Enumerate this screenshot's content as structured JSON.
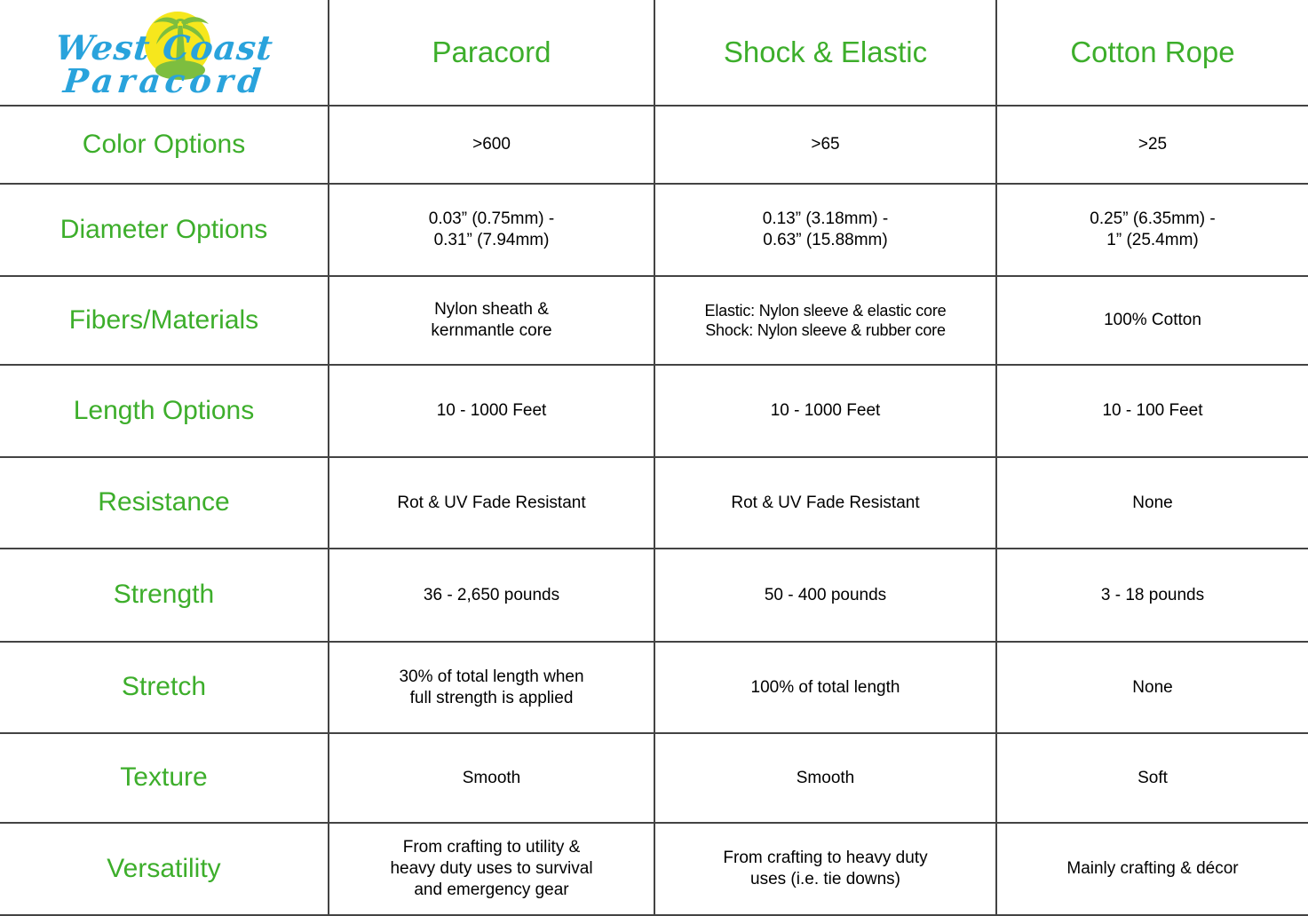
{
  "logo": {
    "line1": "West Coast",
    "line2": "Paracord",
    "brand_blue": "#29A3DC",
    "sun_yellow": "#F6E71D",
    "palm_green": "#7DBE3F",
    "icons": {
      "sun": "sun-icon",
      "palm_tree": "palm-tree-icon"
    }
  },
  "colors": {
    "heading_green": "#3DAE2B",
    "body_text": "#000000",
    "border": "#434343",
    "background": "#FFFFFF"
  },
  "table": {
    "columns": [
      {
        "label": "",
        "name": "logo-column"
      },
      {
        "label": "Paracord",
        "name": "column-paracord"
      },
      {
        "label": "Shock & Elastic",
        "name": "column-shock-elastic"
      },
      {
        "label": "Cotton Rope",
        "name": "column-cotton-rope"
      }
    ],
    "rows": [
      {
        "label": "Color Options",
        "values": [
          ">600",
          ">65",
          ">25"
        ]
      },
      {
        "label": "Diameter Options",
        "values": [
          "0.03” (0.75mm) -\n0.31” (7.94mm)",
          "0.13” (3.18mm) -\n0.63” (15.88mm)",
          "0.25” (6.35mm) -\n1” (25.4mm)"
        ]
      },
      {
        "label": "Fibers/Materials",
        "values": [
          "Nylon sheath &\nkernmantle core",
          "Elastic: Nylon sleeve & elastic core\nShock: Nylon sleeve & rubber core",
          "100% Cotton"
        ]
      },
      {
        "label": "Length Options",
        "values": [
          "10 - 1000 Feet",
          "10 - 1000 Feet",
          "10 - 100 Feet"
        ]
      },
      {
        "label": "Resistance",
        "values": [
          "Rot & UV Fade Resistant",
          "Rot & UV Fade Resistant",
          "None"
        ]
      },
      {
        "label": "Strength",
        "values": [
          "36 - 2,650 pounds",
          "50 - 400 pounds",
          "3 - 18 pounds"
        ]
      },
      {
        "label": "Stretch",
        "values": [
          "30% of total length when\nfull strength is applied",
          "100% of total length",
          "None"
        ]
      },
      {
        "label": "Texture",
        "values": [
          "Smooth",
          "Smooth",
          "Soft"
        ]
      },
      {
        "label": "Versatility",
        "values": [
          "From crafting to utility &\nheavy duty uses to survival\nand emergency gear",
          "From crafting to heavy duty\nuses (i.e. tie downs)",
          "Mainly crafting & décor"
        ]
      }
    ]
  }
}
